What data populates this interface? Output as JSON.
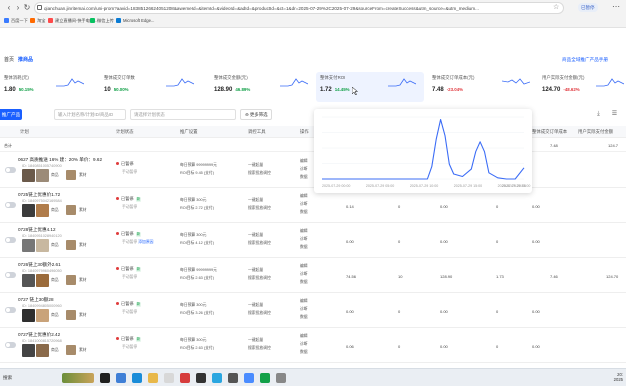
{
  "browser": {
    "url": "qianchuan.jinritemai.com/uni-prom?aavid=18385126624051208&awemeId=&itemId=&videoId=&adId=&productId=&ct=1&dr=2025-07-29%2C2025-07-29&sourceFrom=createSuccess&utm_source=&utm_medium...",
    "paused_label": "已暂停",
    "bookmarks": [
      "百度一下",
      "淘宝",
      "建立直播间-快手电商...",
      "微信上传",
      "Microsoft Edge..."
    ]
  },
  "header": {
    "crumbs": [
      "首页",
      "推商品"
    ],
    "help_link": "商品全域推广产品手册"
  },
  "metrics": [
    {
      "label": "整体消耗(元)",
      "value": "1.80",
      "change": "50.15%",
      "dir": "up"
    },
    {
      "label": "整体成交订单数",
      "value": "10",
      "change": "50.00%",
      "dir": "up"
    },
    {
      "label": "整体成交金额(元)",
      "value": "128.90",
      "change": "46.89%",
      "dir": "up"
    },
    {
      "label": "整体支付ROI",
      "value": "1.72",
      "change": "14.45%",
      "dir": "up"
    },
    {
      "label": "整体成交订单成本(元)",
      "value": "7.48",
      "change": "-23.04%",
      "dir": "down"
    },
    {
      "label": "用户实际支付金额(元)",
      "value": "124.70",
      "change": "-48.62%",
      "dir": "down"
    }
  ],
  "toolbar": {
    "create_label": "推广产品",
    "search_placeholder": "输入计划名称/计划ID/商品ID",
    "status_placeholder": "请选择计划状态",
    "more_filter": "更多筛选"
  },
  "table": {
    "columns": [
      "计划",
      "计划状态",
      "推广设置",
      "调控工具",
      "操作",
      "整体成交订单成本",
      "用户实际支付金额"
    ],
    "summary": {
      "label": "合计",
      "cost": "7.48",
      "amount": "124.7"
    },
    "rows": [
      {
        "name": "0627 高质推送 16%  建：20%  单价：9.62",
        "id": "ID: 1840851005740900",
        "tag": "商品",
        "tag2": "素材",
        "status": "已暂停",
        "sub": "手动暂停",
        "bid1": "每日预算  99999999元",
        "bid2": "ROI目标  9.45 (支付)",
        "tools": [
          "一键起量",
          "搜索投放调控"
        ],
        "ops": [
          "编辑",
          "诊断",
          "数据"
        ],
        "cells": [
          "",
          "",
          "",
          "",
          "",
          "",
          ""
        ]
      },
      {
        "name": "0725链上优惠价1.72",
        "id": "ID: 1840975042169584",
        "tag": "商品",
        "tag2": "素材",
        "status": "已暂停",
        "badge": "新",
        "sub": "手动暂停",
        "bid1": "每日预算  300元",
        "bid2": "ROI目标  2.72 (支付)",
        "tools": [
          "一键起量",
          "搜索投放调控"
        ],
        "ops": [
          "编辑",
          "诊断",
          "数据"
        ],
        "cells": [
          "0.14",
          "0",
          "0.00",
          "0",
          "0.00",
          "",
          ""
        ]
      },
      {
        "name": "0728链上优惠4.12",
        "id": "ID: 1840951028940120",
        "tag": "商品",
        "tag2": "素材",
        "status": "已暂停",
        "badge": "新",
        "sub": "手动暂停",
        "sub_link": "添加原因",
        "bid1": "每日预算  300元",
        "bid2": "ROI目标  4.12 (支付)",
        "tools": [
          "一键起量",
          "搜索投放调控"
        ],
        "ops": [
          "编辑",
          "诊断",
          "数据"
        ],
        "cells": [
          "0.00",
          "0",
          "0.00",
          "0",
          "0.00",
          "",
          ""
        ]
      },
      {
        "name": "0726链上30额外2.61",
        "id": "ID: 1840979960496050",
        "tag": "商品",
        "tag2": "素材",
        "status": "已暂停",
        "badge": "新",
        "sub": "手动暂停",
        "bid1": "每日预算  99999999元",
        "bid2": "ROI目标  2.63 (支付)",
        "tools": [
          "一键起量",
          "搜索投放调控"
        ],
        "ops": [
          "编辑",
          "诊断",
          "数据"
        ],
        "cells": [
          "74.56",
          "10",
          "128.90",
          "1.73",
          "",
          "7.46",
          "124.70"
        ]
      },
      {
        "name": "0727 链上30额28",
        "id": "ID: 1840994805000960",
        "tag": "商品",
        "tag2": "素材",
        "status": "已暂停",
        "badge": "新",
        "sub": "手动暂停",
        "bid1": "每日预算  300元",
        "bid2": "ROI目标  3.26 (支付)",
        "tools": [
          "一键起量",
          "搜索投放调控"
        ],
        "ops": [
          "编辑",
          "诊断",
          "数据"
        ],
        "cells": [
          "0.00",
          "0",
          "0.00",
          "0",
          "0.00",
          "",
          ""
        ]
      },
      {
        "name": "0727链上优惠价2.42",
        "id": "ID: 1841000815720968",
        "tag": "商品",
        "tag2": "素材",
        "status": "已暂停",
        "badge": "新",
        "sub": "手动暂停",
        "bid1": "每日预算  300元",
        "bid2": "ROI目标  2.63 (支付)",
        "tools": [
          "一键起量",
          "搜索投放调控"
        ],
        "ops": [
          "编辑",
          "诊断",
          "数据"
        ],
        "cells": [
          "0.06",
          "0",
          "0.00",
          "0",
          "0.00",
          "",
          ""
        ]
      },
      {
        "name": "0728链上优 票竹3.29",
        "id": "ID: 1841009808711920",
        "tag": "商品",
        "tag2": "素材",
        "status": "已暂停",
        "badge": "新",
        "sub": "手动暂停",
        "bid1": "每日预算  300元",
        "bid2": "ROI目标  2.00 (支付)",
        "tools": [
          "一键起量",
          "搜索投放调控"
        ],
        "ops": [
          "编辑",
          "诊断",
          "数据"
        ],
        "cells": [
          "",
          "",
          "",
          "",
          "",
          "",
          ""
        ]
      }
    ]
  },
  "chart_data": {
    "type": "line",
    "x": [
      "2025-07-29 00:00",
      "2025-07-29 06:00",
      "2025-07-29 12:00",
      "2025-07-29 18:00",
      "2025-07-29 23:00"
    ],
    "x_ticks": [
      "2025-07-29 00:00",
      "2025-07-29 05:00",
      "2025-07-29 10:00",
      "2025-07-29 15:00",
      "2025-07-29 20:00",
      "2025-07-29 23:00"
    ],
    "points": [
      [
        0,
        0
      ],
      [
        1,
        0
      ],
      [
        2,
        0
      ],
      [
        3,
        0
      ],
      [
        4,
        0
      ],
      [
        5,
        0
      ],
      [
        6,
        0
      ],
      [
        7,
        0
      ],
      [
        8,
        0
      ],
      [
        9,
        0
      ],
      [
        10,
        0
      ],
      [
        11,
        0
      ],
      [
        12,
        0
      ],
      [
        12.5,
        1.0
      ],
      [
        13,
        3.2
      ],
      [
        13.5,
        4.8
      ],
      [
        14,
        3.5
      ],
      [
        14.5,
        1.2
      ],
      [
        15,
        0.4
      ],
      [
        16,
        0.2
      ],
      [
        17,
        0.8
      ],
      [
        17.5,
        2.2
      ],
      [
        18,
        3.0
      ],
      [
        18.5,
        2.2
      ],
      [
        19,
        0.5
      ],
      [
        20,
        0.1
      ],
      [
        21,
        0
      ],
      [
        22,
        0
      ],
      [
        23,
        0.9
      ]
    ],
    "ylim": [
      0,
      5
    ],
    "grid": true,
    "color": "#3b6cf6"
  },
  "taskbar": {
    "search": "搜索",
    "time": "20:",
    "date": "2025"
  }
}
